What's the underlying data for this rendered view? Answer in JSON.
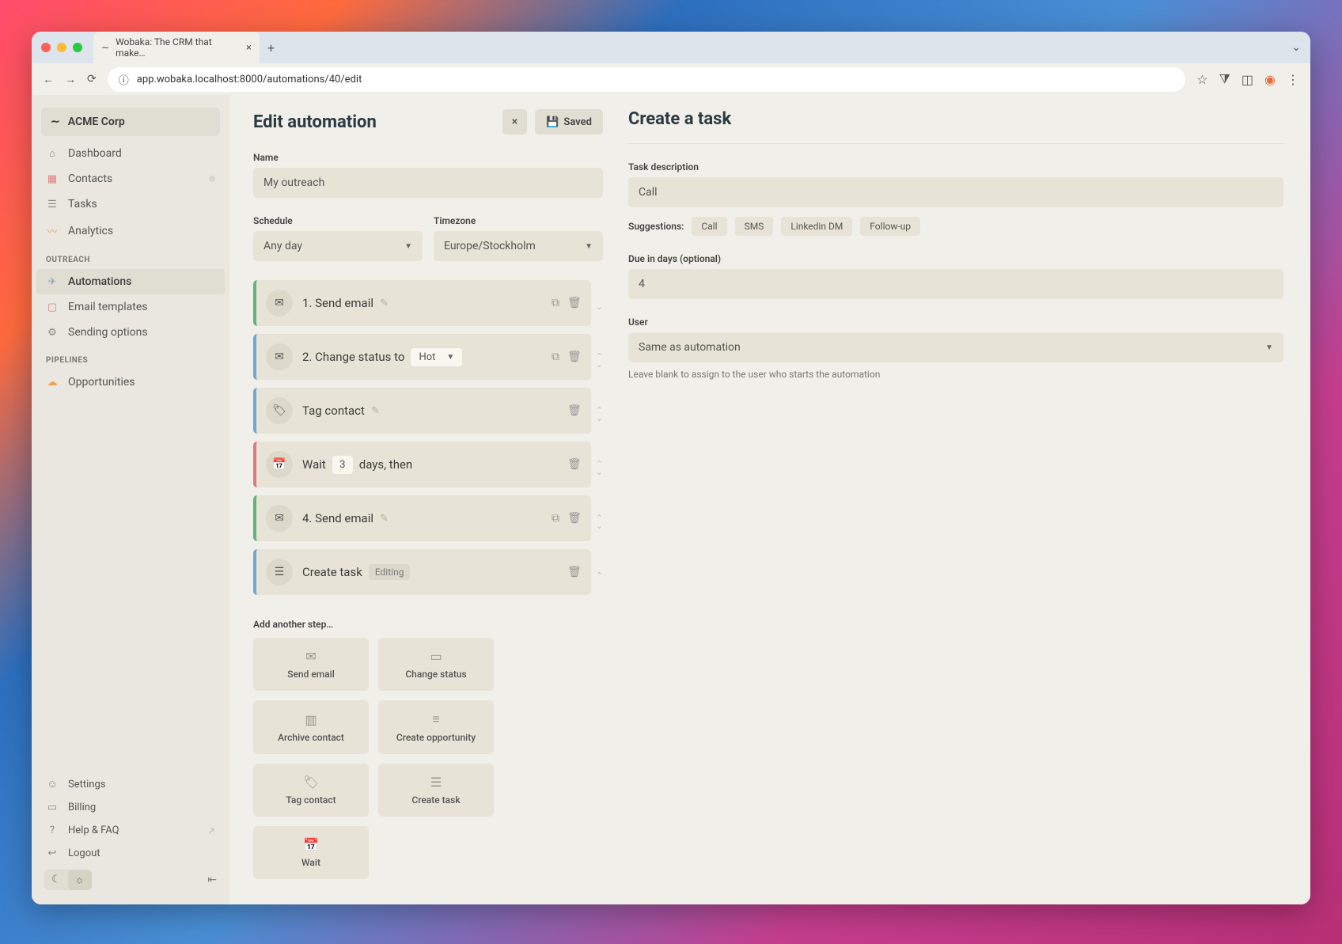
{
  "browser": {
    "tab_title": "Wobaka: The CRM that make…",
    "url": "app.wobaka.localhost:8000/automations/40/edit"
  },
  "org_name": "ACME Corp",
  "sidebar": {
    "main": [
      {
        "label": "Dashboard",
        "icon": "home"
      },
      {
        "label": "Contacts",
        "icon": "contacts"
      },
      {
        "label": "Tasks",
        "icon": "tasks"
      },
      {
        "label": "Analytics",
        "icon": "analytics"
      }
    ],
    "outreach_heading": "OUTREACH",
    "outreach": [
      {
        "label": "Automations",
        "icon": "rocket"
      },
      {
        "label": "Email templates",
        "icon": "mail"
      },
      {
        "label": "Sending options",
        "icon": "settings2"
      }
    ],
    "pipelines_heading": "PIPELINES",
    "pipelines": [
      {
        "label": "Opportunities",
        "icon": "stack"
      }
    ],
    "footer": [
      {
        "label": "Settings"
      },
      {
        "label": "Billing"
      },
      {
        "label": "Help & FAQ"
      },
      {
        "label": "Logout"
      }
    ]
  },
  "page": {
    "title": "Edit automation",
    "close_label": "×",
    "saved_label": "Saved",
    "name_label": "Name",
    "name_value": "My outreach",
    "schedule_label": "Schedule",
    "schedule_value": "Any day",
    "timezone_label": "Timezone",
    "timezone_value": "Europe/Stockholm",
    "steps": [
      {
        "label": "1. Send email"
      },
      {
        "label_prefix": "2. Change status to",
        "dropdown": "Hot"
      },
      {
        "label": "Tag contact"
      },
      {
        "wait_prefix": "Wait",
        "wait_days": "3",
        "wait_suffix": "days, then"
      },
      {
        "label": "4. Send email"
      },
      {
        "label": "Create task",
        "badge": "Editing"
      }
    ],
    "add_another_label": "Add another step…",
    "step_types": [
      "Send email",
      "Change status",
      "Archive contact",
      "Create opportunity",
      "Tag contact",
      "Create task",
      "Wait"
    ]
  },
  "panel": {
    "title": "Create a task",
    "task_description_label": "Task description",
    "task_description_value": "Call",
    "suggestions_label": "Suggestions:",
    "suggestions": [
      "Call",
      "SMS",
      "Linkedin DM",
      "Follow-up"
    ],
    "due_label": "Due in days (optional)",
    "due_value": "4",
    "user_label": "User",
    "user_value": "Same as automation",
    "user_helper": "Leave blank to assign to the user who starts the automation"
  }
}
